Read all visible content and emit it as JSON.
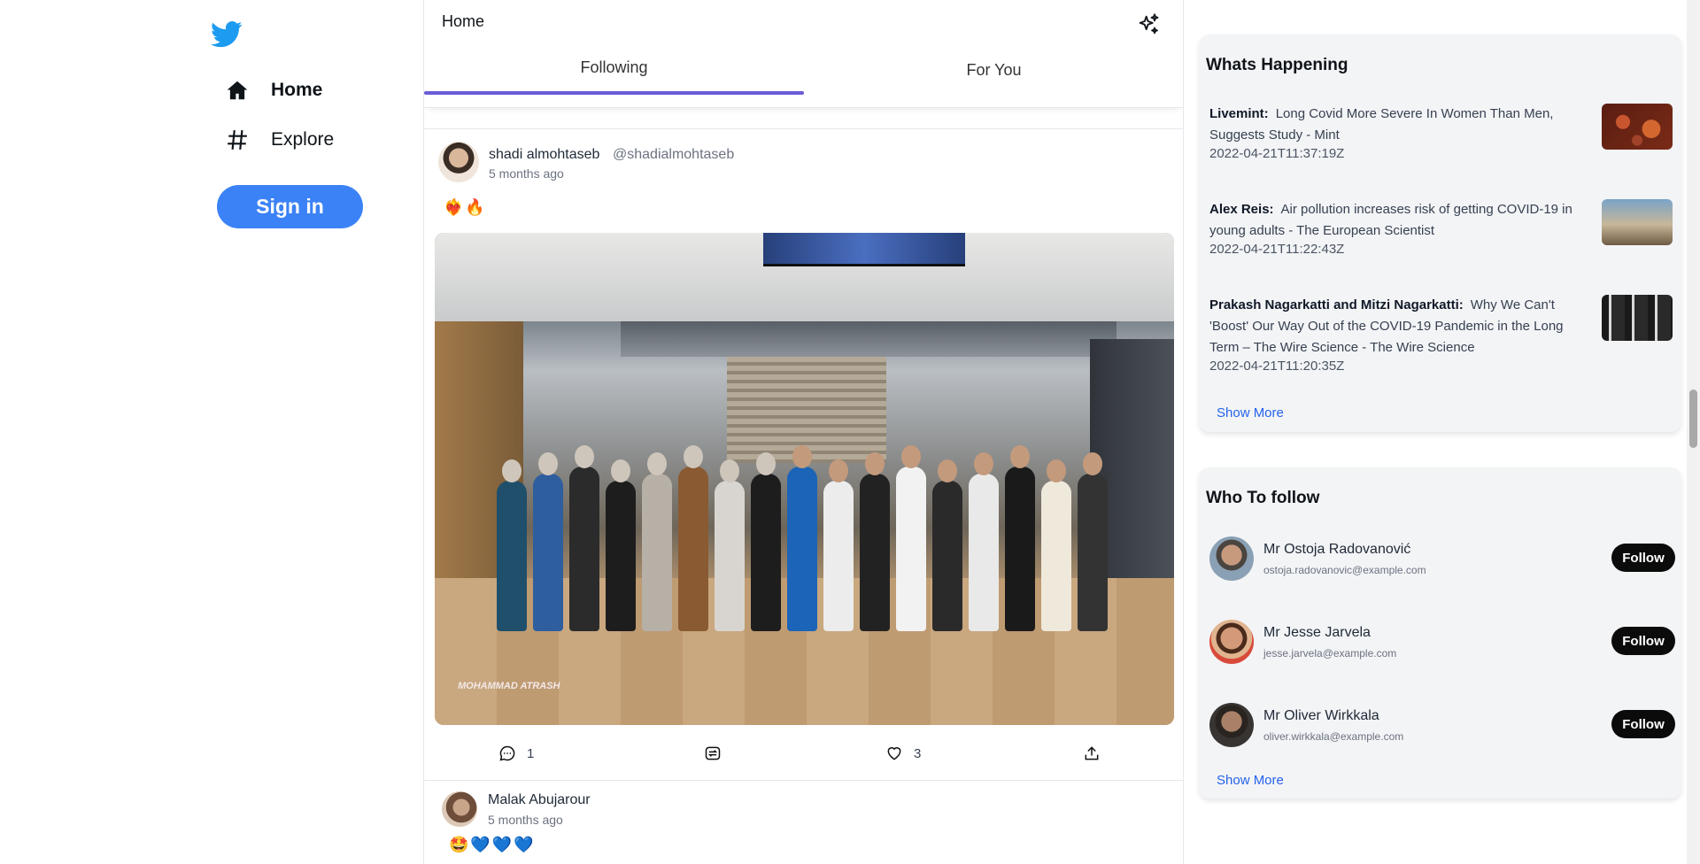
{
  "sidebar": {
    "logo_icon": "twitter-bird-icon",
    "brand_color": "#1d9bf0",
    "items": [
      {
        "label": "Home",
        "icon": "home-icon"
      },
      {
        "label": "Explore",
        "icon": "hashtag-icon"
      }
    ],
    "signin_label": "Sign in",
    "signin_color": "#3b82f6"
  },
  "header": {
    "title": "Home",
    "sparkle_icon": "sparkle-icon",
    "tabs": [
      {
        "label": "Following",
        "active": true
      },
      {
        "label": "For You",
        "active": false
      }
    ],
    "accent": "#6a5bd8"
  },
  "feed": {
    "posts": [
      {
        "name": "shadi almohtaseb",
        "handle": "@shadialmohtaseb",
        "time": "5 months ago",
        "text": "❤️‍🔥🔥",
        "image_caption": "MOHAMMAD ATRASH",
        "comments": "1",
        "likes": "3"
      },
      {
        "name": "Malak Abujarour",
        "time": "5 months ago",
        "text": "🤩💙💙💙"
      }
    ]
  },
  "whats_happening": {
    "title": "Whats Happening",
    "items": [
      {
        "source": "Livemint:",
        "headline": "Long Covid More Severe In Women Than Men, Suggests Study - Mint",
        "date": "2022-04-21T11:37:19Z"
      },
      {
        "source": "Alex Reis:",
        "headline": "Air pollution increases risk of getting COVID-19 in young adults - The European Scientist",
        "date": "2022-04-21T11:22:43Z"
      },
      {
        "source": "Prakash Nagarkatti and Mitzi Nagarkatti:",
        "headline": "Why We Can't 'Boost' Our Way Out of the COVID-19 Pandemic in the Long Term – The Wire Science - The Wire Science",
        "date": "2022-04-21T11:20:35Z"
      }
    ],
    "show_more": "Show More"
  },
  "who_to_follow": {
    "title": "Who To follow",
    "users": [
      {
        "name": "Mr Ostoja Radovanović",
        "email": "ostoja.radovanovic@example.com",
        "button": "Follow"
      },
      {
        "name": "Mr Jesse Jarvela",
        "email": "jesse.jarvela@example.com",
        "button": "Follow"
      },
      {
        "name": "Mr Oliver Wirkkala",
        "email": "oliver.wirkkala@example.com",
        "button": "Follow"
      }
    ],
    "show_more": "Show More"
  }
}
